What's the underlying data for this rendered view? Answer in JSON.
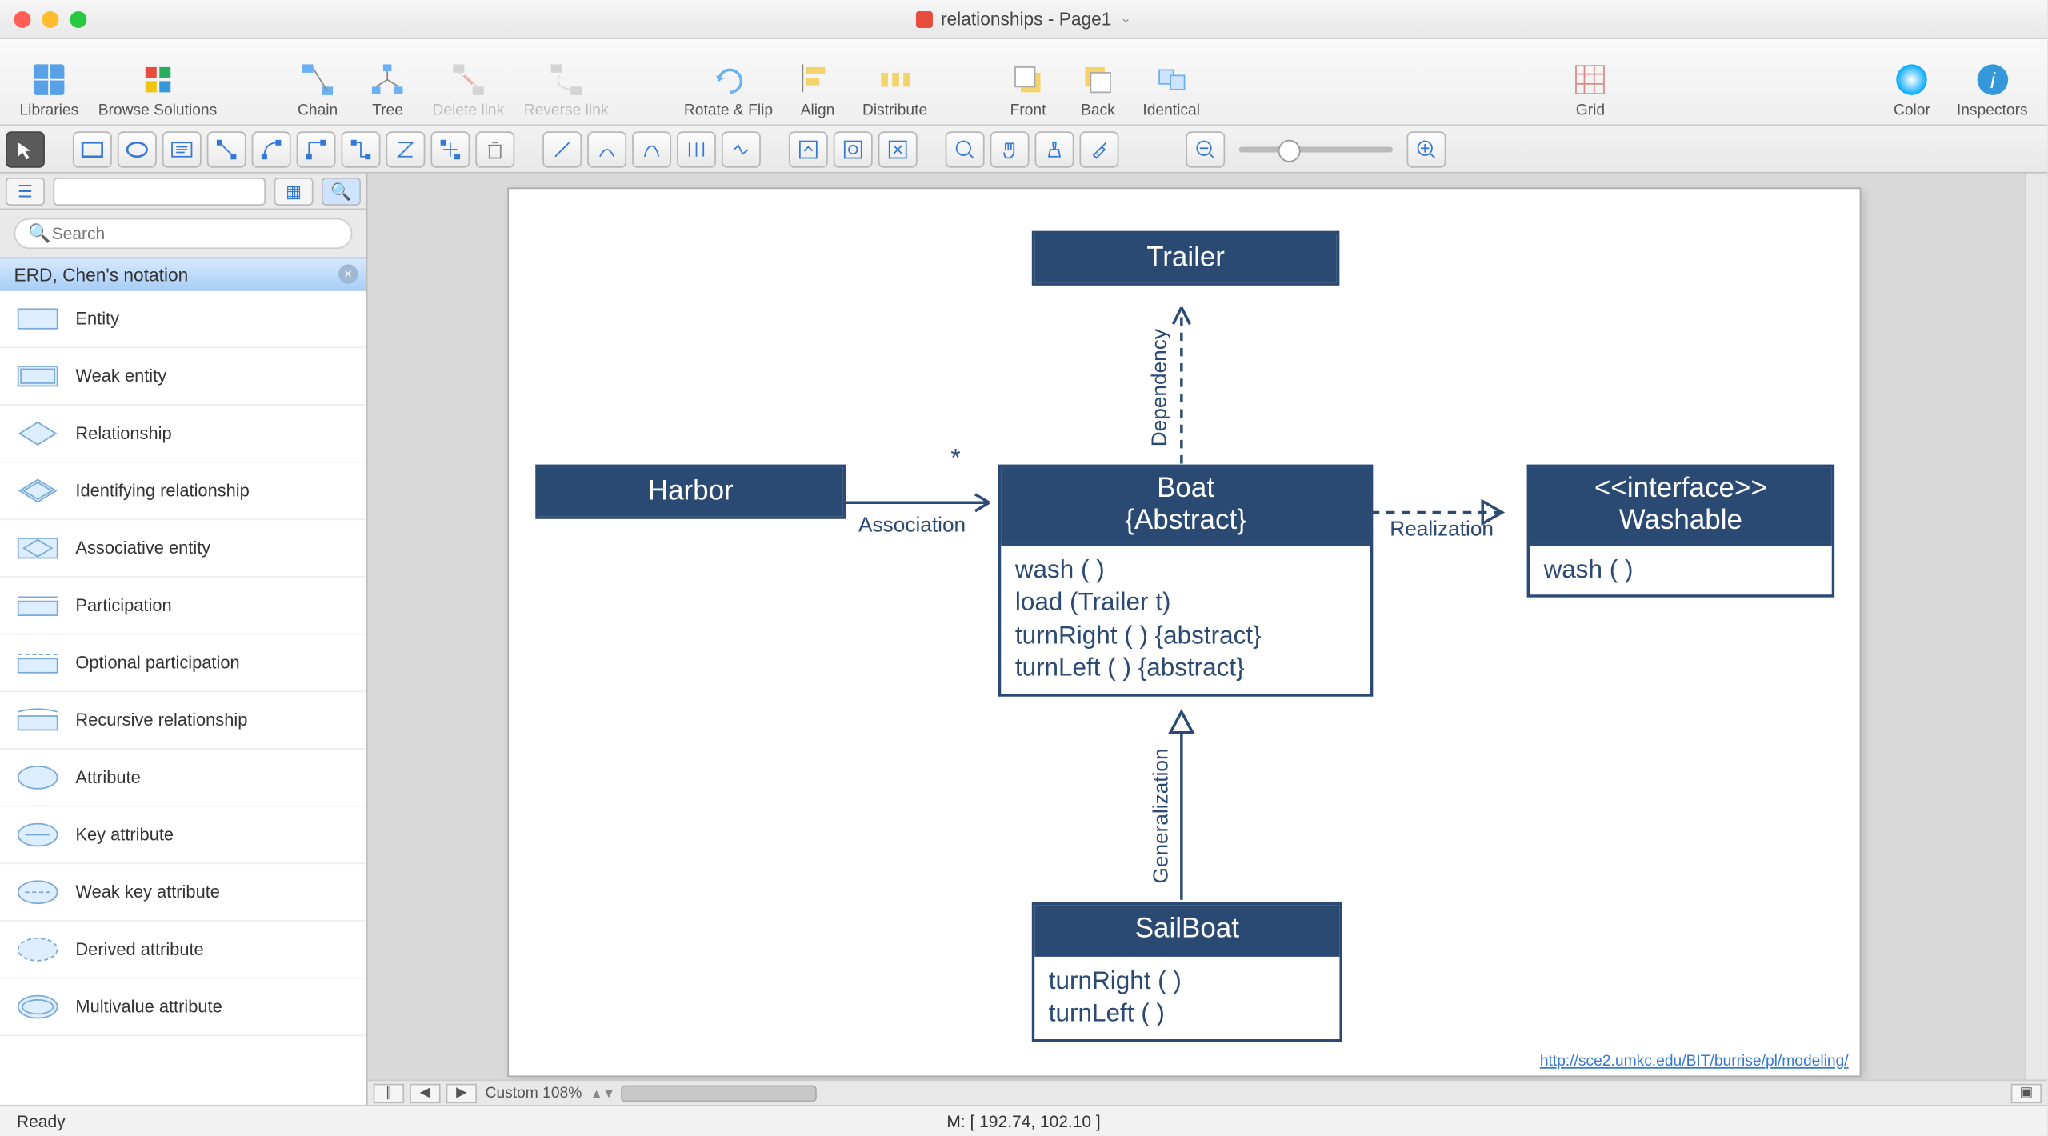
{
  "window": {
    "title": "relationships - Page1"
  },
  "toolbar": {
    "libraries": "Libraries",
    "browse": "Browse Solutions",
    "chain": "Chain",
    "tree": "Tree",
    "delete": "Delete link",
    "reverse": "Reverse link",
    "rotate": "Rotate & Flip",
    "align": "Align",
    "distribute": "Distribute",
    "front": "Front",
    "back": "Back",
    "identical": "Identical",
    "grid": "Grid",
    "color": "Color",
    "inspectors": "Inspectors"
  },
  "sidebar": {
    "search_placeholder": "Search",
    "section": "ERD, Chen's notation",
    "items": [
      "Entity",
      "Weak entity",
      "Relationship",
      "Identifying relationship",
      "Associative entity",
      "Participation",
      "Optional participation",
      "Recursive relationship",
      "Attribute",
      "Key attribute",
      "Weak key attribute",
      "Derived attribute",
      "Multivalue attribute"
    ]
  },
  "diagram": {
    "trailer": {
      "title": "Trailer"
    },
    "harbor": {
      "title": "Harbor"
    },
    "boat": {
      "title": "Boat",
      "subtitle": "{Abstract}",
      "ops": [
        "wash ( )",
        "load (Trailer t)",
        "turnRight ( ) {abstract}",
        "turnLeft ( ) {abstract}"
      ]
    },
    "washable": {
      "stereo": "<<interface>>",
      "title": "Washable",
      "ops": [
        "wash ( )"
      ]
    },
    "sailboat": {
      "title": "SailBoat",
      "ops": [
        "turnRight ( )",
        "turnLeft ( )"
      ]
    },
    "labels": {
      "dependency": "Dependency",
      "association": "Association",
      "star": "*",
      "realization": "Realization",
      "generalization": "Generalization"
    },
    "url": "http://sce2.umkc.edu/BIT/burrise/pl/modeling/"
  },
  "footer": {
    "zoom": "Custom 108%",
    "ready": "Ready",
    "mouse": "M: [ 192.74, 102.10 ]"
  }
}
